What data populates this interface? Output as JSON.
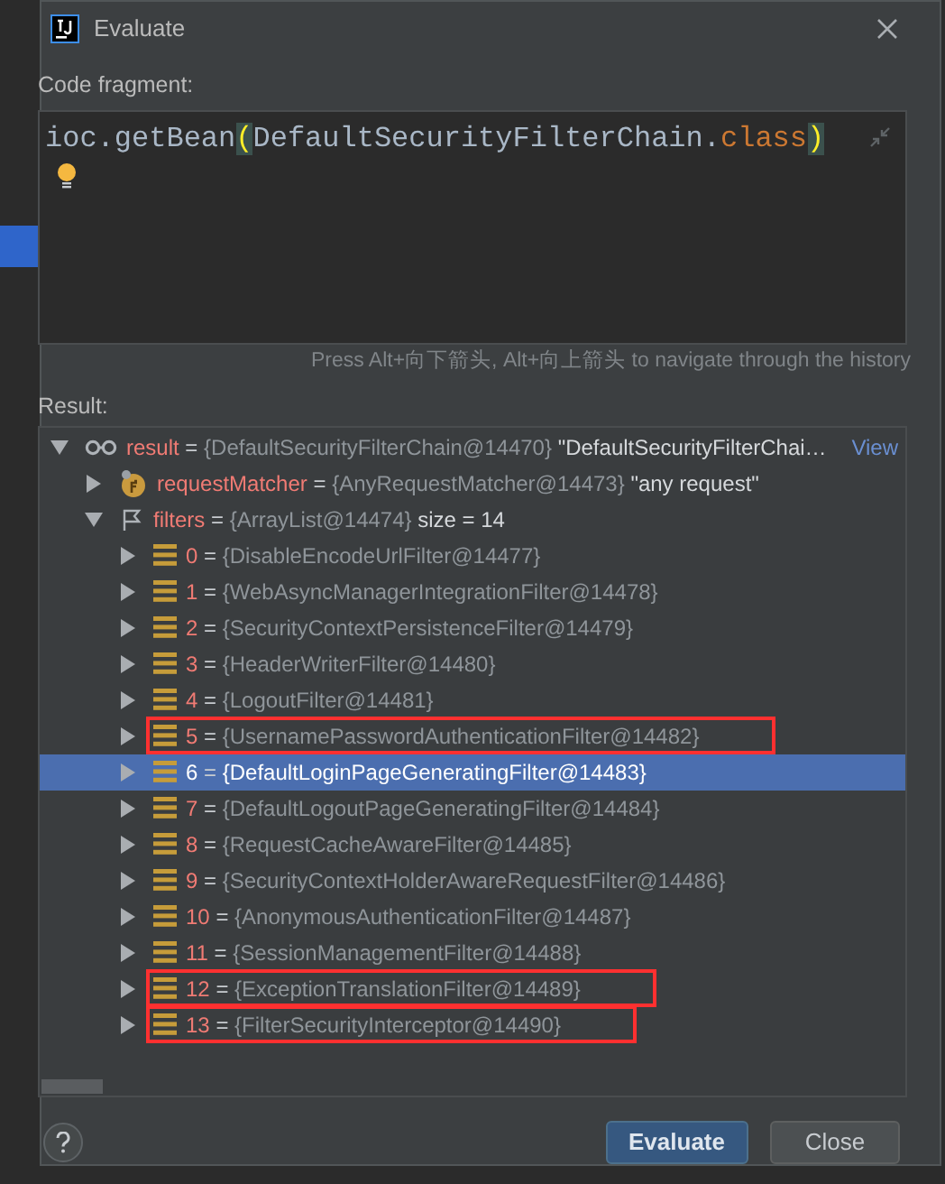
{
  "window": {
    "title": "Evaluate"
  },
  "code_fragment": {
    "label": "Code fragment:",
    "tokens": [
      {
        "kind": "plain",
        "text": "ioc.getBean"
      },
      {
        "kind": "brace",
        "text": "("
      },
      {
        "kind": "plain",
        "text": "DefaultSecurityFilterChain."
      },
      {
        "kind": "keyword",
        "text": "class"
      },
      {
        "kind": "brace",
        "text": ")"
      }
    ],
    "hint": "Press Alt+向下箭头, Alt+向上箭头 to navigate through the history"
  },
  "result": {
    "label": "Result:",
    "tree": [
      {
        "kind": "watch",
        "name": "result",
        "sep": "=",
        "ref": "{DefaultSecurityFilterChain@14470}",
        "value": "\"DefaultSecurityFilterChai…",
        "link": "View",
        "expanded": true,
        "selected": false,
        "highlighted": false,
        "children": [
          {
            "kind": "field",
            "name": "requestMatcher",
            "sep": "=",
            "ref": "{AnyRequestMatcher@14473}",
            "value": "\"any request\"",
            "expanded": false,
            "selected": false,
            "highlighted": false
          },
          {
            "kind": "flag",
            "name": "filters",
            "sep": "=",
            "ref": "{ArrayList@14474}",
            "value": "size = 14",
            "expanded": true,
            "selected": false,
            "highlighted": false,
            "children": [
              {
                "kind": "element",
                "name": "0",
                "sep": "=",
                "ref": "{DisableEncodeUrlFilter@14477}",
                "expanded": false,
                "selected": false,
                "highlighted": false
              },
              {
                "kind": "element",
                "name": "1",
                "sep": "=",
                "ref": "{WebAsyncManagerIntegrationFilter@14478}",
                "expanded": false,
                "selected": false,
                "highlighted": false
              },
              {
                "kind": "element",
                "name": "2",
                "sep": "=",
                "ref": "{SecurityContextPersistenceFilter@14479}",
                "expanded": false,
                "selected": false,
                "highlighted": false
              },
              {
                "kind": "element",
                "name": "3",
                "sep": "=",
                "ref": "{HeaderWriterFilter@14480}",
                "expanded": false,
                "selected": false,
                "highlighted": false
              },
              {
                "kind": "element",
                "name": "4",
                "sep": "=",
                "ref": "{LogoutFilter@14481}",
                "expanded": false,
                "selected": false,
                "highlighted": false
              },
              {
                "kind": "element",
                "name": "5",
                "sep": "=",
                "ref": "{UsernamePasswordAuthenticationFilter@14482}",
                "expanded": false,
                "selected": false,
                "highlighted": true
              },
              {
                "kind": "element",
                "name": "6",
                "sep": "=",
                "ref": "{DefaultLoginPageGeneratingFilter@14483}",
                "expanded": false,
                "selected": true,
                "highlighted": false
              },
              {
                "kind": "element",
                "name": "7",
                "sep": "=",
                "ref": "{DefaultLogoutPageGeneratingFilter@14484}",
                "expanded": false,
                "selected": false,
                "highlighted": false
              },
              {
                "kind": "element",
                "name": "8",
                "sep": "=",
                "ref": "{RequestCacheAwareFilter@14485}",
                "expanded": false,
                "selected": false,
                "highlighted": false
              },
              {
                "kind": "element",
                "name": "9",
                "sep": "=",
                "ref": "{SecurityContextHolderAwareRequestFilter@14486}",
                "expanded": false,
                "selected": false,
                "highlighted": false
              },
              {
                "kind": "element",
                "name": "10",
                "sep": "=",
                "ref": "{AnonymousAuthenticationFilter@14487}",
                "expanded": false,
                "selected": false,
                "highlighted": false
              },
              {
                "kind": "element",
                "name": "11",
                "sep": "=",
                "ref": "{SessionManagementFilter@14488}",
                "expanded": false,
                "selected": false,
                "highlighted": false
              },
              {
                "kind": "element",
                "name": "12",
                "sep": "=",
                "ref": "{ExceptionTranslationFilter@14489}",
                "expanded": false,
                "selected": false,
                "highlighted": true
              },
              {
                "kind": "element",
                "name": "13",
                "sep": "=",
                "ref": "{FilterSecurityInterceptor@14490}",
                "expanded": false,
                "selected": false,
                "highlighted": true
              }
            ]
          }
        ]
      }
    ]
  },
  "buttons": [
    {
      "kind": "primary",
      "label": "Evaluate"
    },
    {
      "kind": "secondary",
      "label": "Close"
    }
  ]
}
